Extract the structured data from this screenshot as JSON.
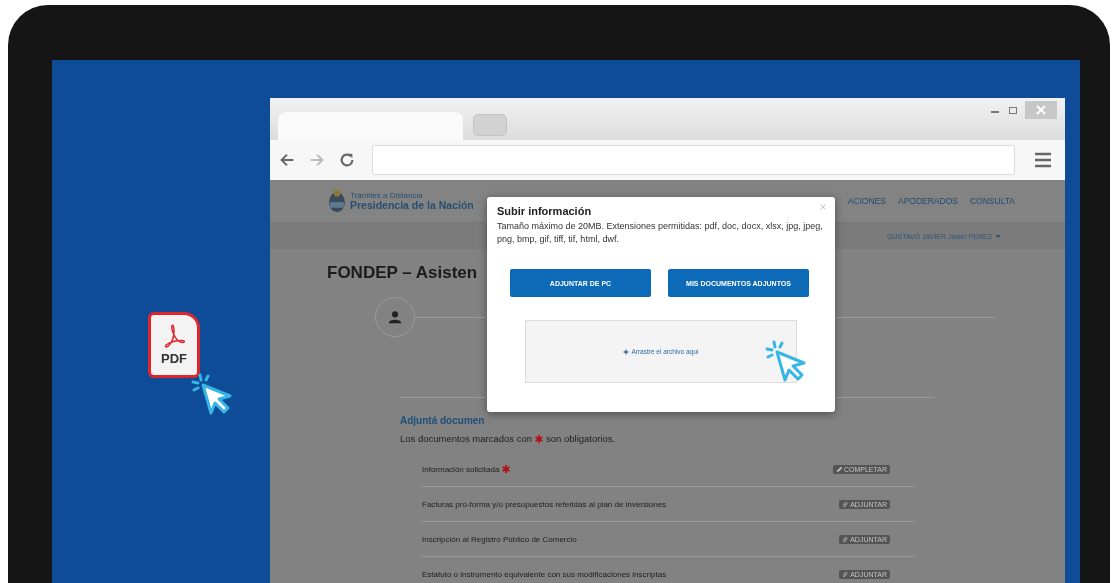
{
  "illustration": {
    "file_label": "PDF"
  },
  "browser": {
    "tabs": [
      {
        "selected": true
      },
      {
        "selected": false
      }
    ]
  },
  "site": {
    "brand_small": "Trámites a Distancia",
    "brand": "Presidencia de la Nación",
    "nav": [
      "ACIONES",
      "APODERADOS",
      "CONSULTA"
    ],
    "user": "GUSTAVO JAVIER Javier PEREZ"
  },
  "page": {
    "title": "FONDEP – Asisten",
    "section_title": "Adjuntá documen",
    "note_start": "Los documentos marcados con",
    "note_end": "son obligatorios."
  },
  "documents": [
    {
      "name": "Información solicitada",
      "required": true,
      "action": {
        "kind": "complete",
        "label": "COMPLETAR"
      }
    },
    {
      "name": "Facturas pro-forma y/o presupuestos referidas al plan de inversiones",
      "required": false,
      "action": {
        "kind": "attach",
        "label": "ADJUNTAR"
      }
    },
    {
      "name": "Inscripción al Registro Público de Comercio",
      "required": false,
      "action": {
        "kind": "attach",
        "label": "ADJUNTAR"
      }
    },
    {
      "name": "Estatuto o instrumento equivalente con sus modificaciones inscriptas",
      "required": false,
      "action": {
        "kind": "attach",
        "label": "ADJUNTAR"
      }
    }
  ],
  "modal": {
    "title": "Subir información",
    "description": "Tamaño máximo de 20MB. Extensiones permitidas: pdf, doc, docx, xlsx, jpg, jpeg, png, bmp, gif, tiff, tif, html, dwf.",
    "buttons": [
      "ADJUNTAR DE PC",
      "MIS DOCUMENTOS ADJUNTOS"
    ],
    "dropzone": "Arrastre el archivo aquí"
  }
}
